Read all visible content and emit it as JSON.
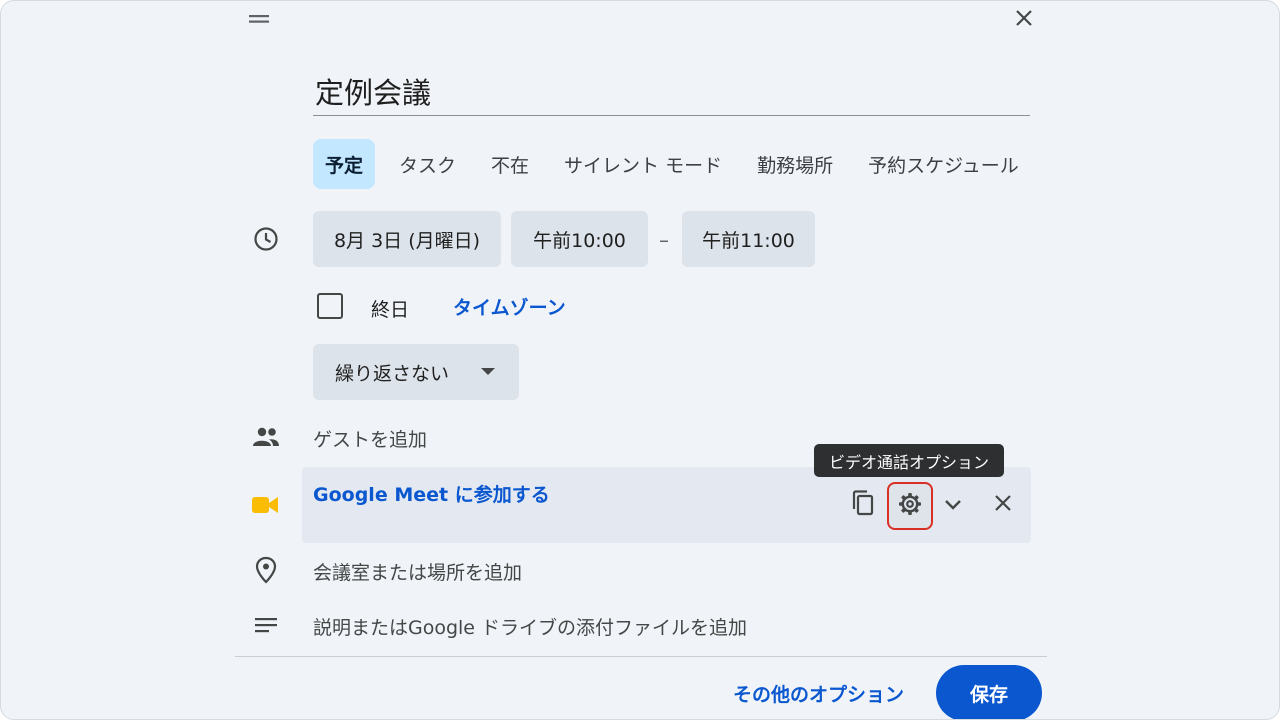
{
  "event": {
    "title": "定例会議"
  },
  "tabs": [
    {
      "label": "予定",
      "active": true
    },
    {
      "label": "タスク",
      "active": false
    },
    {
      "label": "不在",
      "active": false
    },
    {
      "label": "サイレント モード",
      "active": false
    },
    {
      "label": "勤務場所",
      "active": false
    },
    {
      "label": "予約スケジュール",
      "active": false
    }
  ],
  "datetime": {
    "date": "8月 3日 (月曜日)",
    "start_time": "午前10:00",
    "separator": "–",
    "end_time": "午前11:00"
  },
  "allday": {
    "label": "終日",
    "checked": false,
    "timezone_link": "タイムゾーン"
  },
  "recurrence": {
    "selected": "繰り返さない"
  },
  "guests": {
    "placeholder": "ゲストを追加"
  },
  "meet": {
    "link_label": "Google Meet に参加する",
    "tooltip": "ビデオ通話オプション"
  },
  "location": {
    "placeholder": "会議室または場所を追加"
  },
  "description": {
    "placeholder": "説明またはGoogle ドライブの添付ファイルを追加"
  },
  "footer": {
    "more_options": "その他のオプション",
    "save": "保存"
  },
  "icons": {
    "drag": "drag-handle-icon",
    "close": "close-icon",
    "clock": "clock-icon",
    "people": "people-icon",
    "meet": "google-meet-icon",
    "copy": "copy-icon",
    "gear": "gear-icon",
    "chevron": "chevron-down-icon",
    "location": "location-pin-icon",
    "notes": "notes-icon"
  },
  "colors": {
    "accent": "#0b57d0",
    "active_tab": "#c2e7ff",
    "chip": "#dde3ea",
    "highlight_border": "#d93025",
    "meet_yellow": "#fbbc04"
  }
}
